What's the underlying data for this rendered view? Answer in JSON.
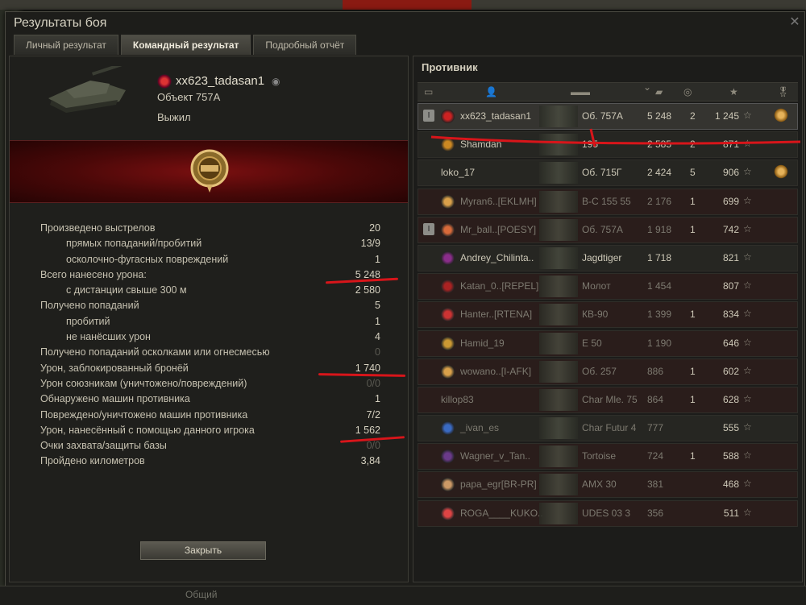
{
  "window": {
    "title": "Результаты боя"
  },
  "tabs": [
    "Личный результат",
    "Командный результат",
    "Подробный отчёт"
  ],
  "player": {
    "name": "xx623_tadasan1",
    "vehicle": "Объект 757А",
    "status": "Выжил"
  },
  "stats": [
    {
      "label": "Произведено выстрелов",
      "value": "20",
      "indent": false
    },
    {
      "label": "прямых попаданий/пробитий",
      "value": "13/9",
      "indent": true
    },
    {
      "label": "осколочно-фугасных повреждений",
      "value": "1",
      "indent": true
    },
    {
      "label": "Всего нанесено урона:",
      "value": "5 248",
      "indent": false
    },
    {
      "label": "с дистанции свыше 300 м",
      "value": "2 580",
      "indent": true
    },
    {
      "label": "Получено попаданий",
      "value": "5",
      "indent": false
    },
    {
      "label": "пробитий",
      "value": "1",
      "indent": true
    },
    {
      "label": "не нанёсших урон",
      "value": "4",
      "indent": true
    },
    {
      "label": "Получено попаданий осколками или огнесмесью",
      "value": "0",
      "indent": false,
      "dim": true
    },
    {
      "label": "Урон, заблокированный бронёй",
      "value": "1 740",
      "indent": false
    },
    {
      "label": "Урон союзникам (уничтожено/повреждений)",
      "value": "0/0",
      "indent": false,
      "dim": true
    },
    {
      "label": "Обнаружено машин противника",
      "value": "1",
      "indent": false
    },
    {
      "label": "Повреждено/уничтожено машин противника",
      "value": "7/2",
      "indent": false
    },
    {
      "label": "Урон, нанесённый с помощью данного игрока",
      "value": "1 562",
      "indent": false
    },
    {
      "label": "Очки захвата/защиты базы",
      "value": "0/0",
      "indent": false,
      "dim": true
    },
    {
      "label": "Пройдено километров",
      "value": "3,84",
      "indent": false
    }
  ],
  "close_label": "Закрыть",
  "enemy": {
    "header": "Противник",
    "rows": [
      {
        "name": "xx623_tadasan1",
        "tank": "Об. 757А",
        "damage": "5 248",
        "kills": "2",
        "xp": "1 245",
        "award": true,
        "me": true,
        "badge": "I",
        "clan_color": "#c22"
      },
      {
        "name": "Shamdan",
        "tank": "195",
        "damage": "2 585",
        "kills": "2",
        "xp": "871",
        "clan_color": "#c82"
      },
      {
        "name": "loko_17",
        "tank": "Об. 715Г",
        "damage": "2 424",
        "kills": "5",
        "xp": "906",
        "award": true,
        "noclan": true
      },
      {
        "name": "Myran6..[EKLMH]",
        "tank": "В-С 155 55",
        "damage": "2 176",
        "kills": "1",
        "xp": "699",
        "dark": true,
        "dim": true,
        "clan_color": "#d9a04a"
      },
      {
        "name": "Mr_ball..[POESY]",
        "tank": "Об. 757А",
        "damage": "1 918",
        "kills": "1",
        "xp": "742",
        "dark": true,
        "dim": true,
        "badge": "I",
        "clan_color": "#d86a3a"
      },
      {
        "name": "Andrey_Chilinta..",
        "tank": "Jagdtiger",
        "damage": "1 718",
        "kills": "",
        "xp": "821",
        "clan_color": "#8a2d8a"
      },
      {
        "name": "Katan_0..[REPEL]",
        "tank": "Молот",
        "damage": "1 454",
        "kills": "",
        "xp": "807",
        "dark": true,
        "dim": true,
        "clan_color": "#a22"
      },
      {
        "name": "Hanter..[RTENA]",
        "tank": "КВ-90",
        "damage": "1 399",
        "kills": "1",
        "xp": "834",
        "dark": true,
        "dim": true,
        "clan_color": "#c33"
      },
      {
        "name": "Hamid_19",
        "tank": "E 50",
        "damage": "1 190",
        "kills": "",
        "xp": "646",
        "dark": true,
        "dim": true,
        "clan_color": "#c93"
      },
      {
        "name": "wowano..[I-AFK]",
        "tank": "Об. 257",
        "damage": "886",
        "kills": "1",
        "xp": "602",
        "dark": true,
        "dim": true,
        "clan_color": "#d9a04a"
      },
      {
        "name": "killop83",
        "tank": "Char Mle. 75",
        "damage": "864",
        "kills": "1",
        "xp": "628",
        "dark": true,
        "dim": true,
        "noclan": true
      },
      {
        "name": "_ivan_es",
        "tank": "Char Futur 4",
        "damage": "777",
        "kills": "",
        "xp": "555",
        "dim": true,
        "clan_color": "#3a6ac2"
      },
      {
        "name": "Wagner_v_Tan..",
        "tank": "Tortoise",
        "damage": "724",
        "kills": "1",
        "xp": "588",
        "dark": true,
        "dim": true,
        "clan_color": "#6a3a8a"
      },
      {
        "name": "papa_egr[BR-PR]",
        "tank": "AMX 30",
        "damage": "381",
        "kills": "",
        "xp": "468",
        "dark": true,
        "dim": true,
        "clan_color": "#c96"
      },
      {
        "name": "ROGA____KUKO..",
        "tank": "UDES 03 3",
        "damage": "356",
        "kills": "",
        "xp": "511",
        "dark": true,
        "dim": true,
        "clan_color": "#d44"
      }
    ]
  },
  "bottom": {
    "chat_label": "Общий"
  }
}
